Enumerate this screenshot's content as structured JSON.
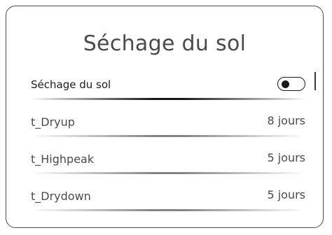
{
  "screen": {
    "title": "Séchage du sol"
  },
  "header_row": {
    "label": "Séchage du sol",
    "toggle_state": "off"
  },
  "parameters": [
    {
      "label": "t_Dryup",
      "value": "8 jours"
    },
    {
      "label": "t_Highpeak",
      "value": "5 jours"
    },
    {
      "label": "t_Drydown",
      "value": "5 jours"
    }
  ],
  "colors": {
    "border": "#4a4a4a",
    "text": "#4a4a4a",
    "accent_dark": "#1a1a1a",
    "background": "#ffffff"
  }
}
